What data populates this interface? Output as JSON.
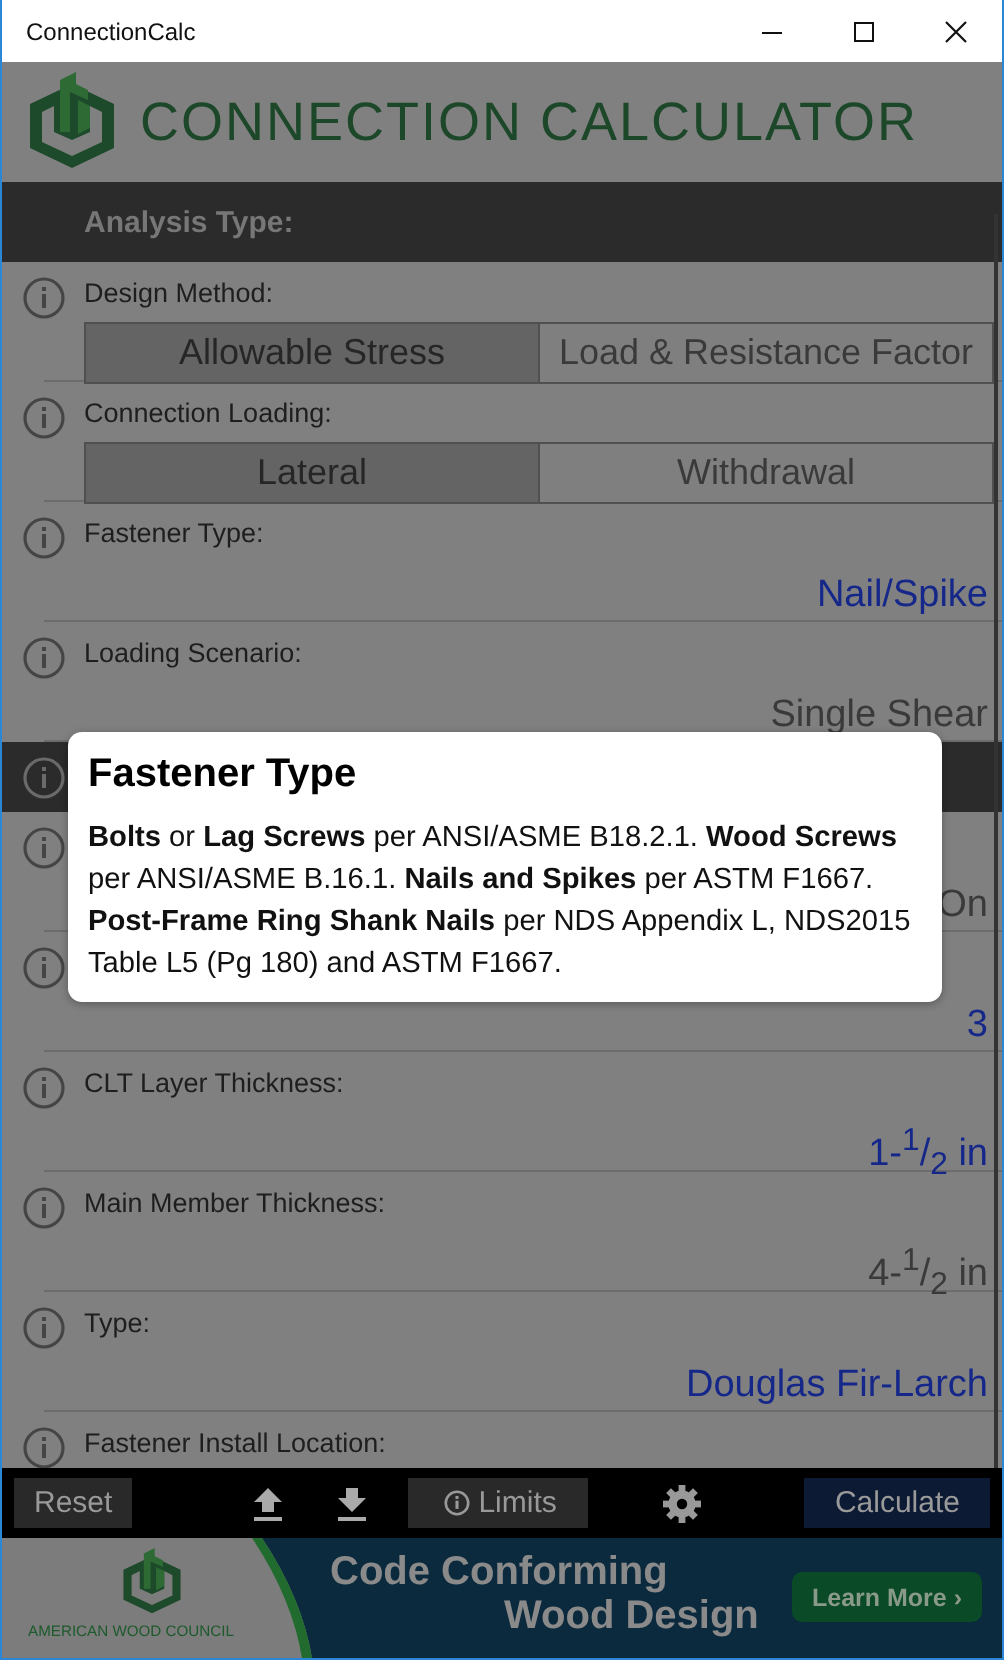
{
  "window": {
    "title": "ConnectionCalc"
  },
  "header": {
    "title": "CONNECTION CALCULATOR"
  },
  "sections": [
    {
      "heading": "Analysis Type:",
      "rows": [
        {
          "kind": "segmented",
          "label": "Design Method:",
          "options": [
            {
              "label": "Allowable Stress",
              "selected": true
            },
            {
              "label": "Load & Resistance Factor",
              "selected": false
            }
          ]
        },
        {
          "kind": "segmented",
          "label": "Connection Loading:",
          "options": [
            {
              "label": "Lateral",
              "selected": true
            },
            {
              "label": "Withdrawal",
              "selected": false
            }
          ]
        },
        {
          "kind": "value",
          "label": "Fastener Type:",
          "value": "Nail/Spike",
          "disabled": false
        },
        {
          "kind": "value",
          "label": "Loading Scenario:",
          "value": "Single Shear",
          "disabled": true
        }
      ]
    },
    {
      "rows": [
        {
          "kind": "value",
          "value": "On",
          "disabled": true
        },
        {
          "kind": "value",
          "value": "3",
          "disabled": false
        },
        {
          "kind": "value",
          "label": "CLT Layer Thickness:",
          "value": "1-$^{1}$/$_{2}$ in",
          "disabled": false
        },
        {
          "kind": "value",
          "label": "Main Member Thickness:",
          "value": "4-$^{1}$/$_{2}$ in",
          "disabled": true
        },
        {
          "kind": "value",
          "label": "Type:",
          "value": "Douglas Fir-Larch",
          "disabled": false
        },
        {
          "kind": "label",
          "label": "Fastener Install Location:"
        }
      ]
    }
  ],
  "toolbar": [
    {
      "kind": "button",
      "label": "Reset"
    },
    {
      "kind": "upload"
    },
    {
      "kind": "download"
    },
    {
      "kind": "info-button",
      "label": "Limits"
    },
    {
      "kind": "settings"
    },
    {
      "kind": "primary",
      "label": "Calculate"
    }
  ],
  "banner": {
    "org": "AMERICAN WOOD COUNCIL",
    "headline": [
      "Code Conforming",
      "Wood Design"
    ],
    "button": "Learn More ›"
  },
  "popup": {
    "title": "Fastener Type",
    "body": "**Bolts** or **Lag Screws** per ANSI/ASME B18.2.1. **Wood Screws** per ANSI/ASME B.16.1. **Nails and Spikes** per ASTM F1667. **Post-Frame Ring Shank Nails** per NDS Appendix L, NDS2015 Table L5 (Pg 180) and ASTM F1667."
  }
}
